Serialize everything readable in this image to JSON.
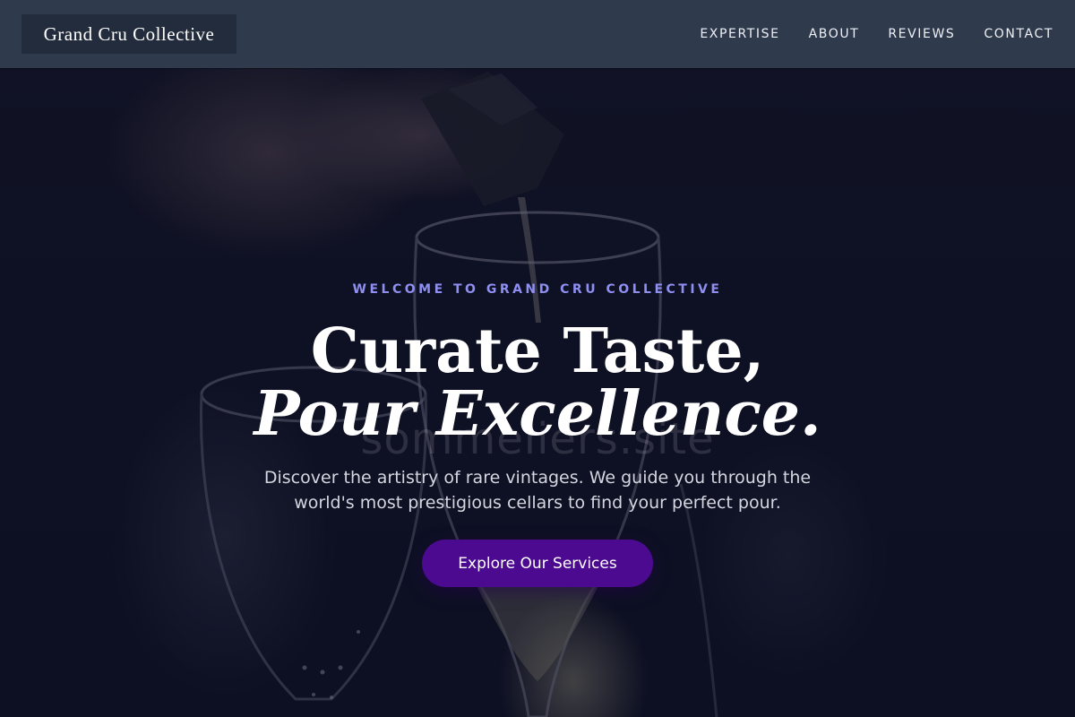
{
  "header": {
    "logo_text": "Grand Cru Collective",
    "nav": [
      {
        "label": "EXPERTISE"
      },
      {
        "label": "ABOUT"
      },
      {
        "label": "REVIEWS"
      },
      {
        "label": "CONTACT"
      }
    ]
  },
  "hero": {
    "eyebrow": "WELCOME TO GRAND CRU COLLECTIVE",
    "headline_line1": "Curate Taste,",
    "headline_line2": "Pour Excellence.",
    "subtitle": "Discover the artistry of rare vintages. We guide you through the world's most prestigious cellars to find your perfect pour.",
    "cta_label": "Explore Our Services",
    "watermark": "sommeliers.site",
    "background_image": "sommelier-pouring-wine-photo"
  },
  "colors": {
    "header_bg": "#2f3a4d",
    "logo_bg": "#232c3c",
    "eyebrow": "#8e8ff0",
    "cta_bg": "#4b0a8f",
    "overlay": "#0a0c20"
  }
}
